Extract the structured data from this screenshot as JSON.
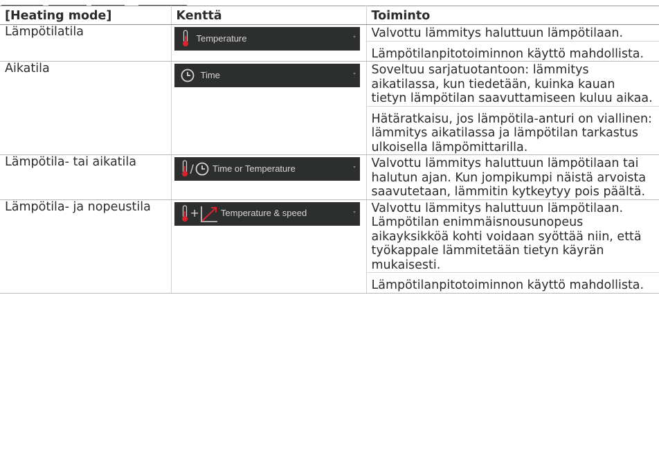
{
  "header": {
    "col1": "[Heating mode]",
    "col2": "Kenttä",
    "col3": "Toiminto"
  },
  "rows": [
    {
      "mode": "Lämpötilatila",
      "field": {
        "label": "Temperature",
        "icons": [
          "thermometer-icon"
        ]
      },
      "desc": [
        "Valvottu lämmitys haluttuun lämpötilaan.",
        "Lämpötilanpitotoiminnon käyttö mahdollista."
      ]
    },
    {
      "mode": "Aikatila",
      "field": {
        "label": "Time",
        "icons": [
          "clock-icon"
        ]
      },
      "desc": [
        "Soveltuu sarjatuotantoon: lämmitys aikatilassa, kun tiedetään, kuinka kauan tietyn lämpötilan saavuttamiseen kuluu aikaa.",
        "Hätäratkaisu, jos lämpötila-anturi on viallinen: lämmitys aikatilassa ja lämpötilan tarkastus ulkoisella lämpömittarilla."
      ]
    },
    {
      "mode": "Lämpötila- tai aikatila",
      "field": {
        "label": "Time or Temperature",
        "icons": [
          "thermometer-icon",
          "clock-icon"
        ],
        "separator": "/"
      },
      "desc": [
        "Valvottu lämmitys haluttuun lämpötilaan tai halutun ajan. Kun jompikumpi näistä arvoista saavutetaan, lämmitin kytkeytyy pois päältä."
      ]
    },
    {
      "mode": "Lämpötila- ja nopeustila",
      "field": {
        "label": "Temperature & speed",
        "icons": [
          "thermometer-icon",
          "rising-graph-icon"
        ],
        "separator": "+"
      },
      "desc": [
        "Valvottu lämmitys haluttuun lämpötilaan. Lämpötilan enimmäisnousunopeus aikayksikköä kohti voidaan syöttää niin, että työkappale lämmitetään tietyn käyrän mukaisesti.",
        "Lämpötilanpitotoiminnon käyttö mahdollista."
      ]
    }
  ],
  "colors": {
    "selector_bg": "#2d2e2e",
    "selector_text": "#d6d6d6",
    "thermometer_red": "#d9232e",
    "graph_red": "#d9232e"
  }
}
